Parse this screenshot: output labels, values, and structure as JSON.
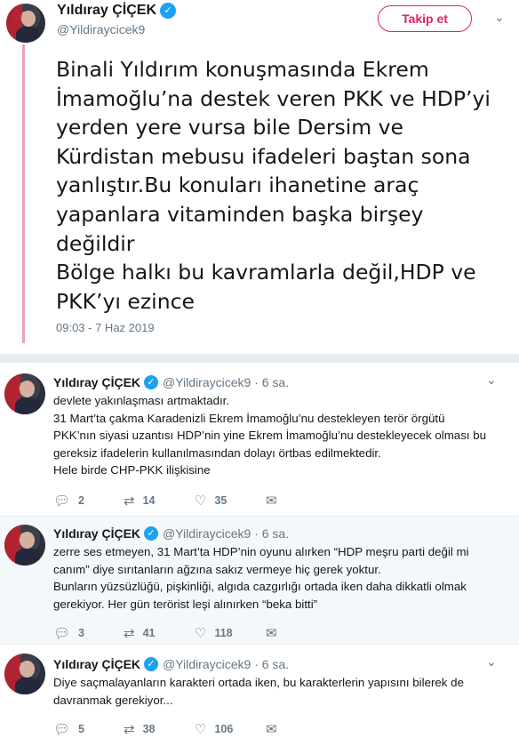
{
  "main_tweet": {
    "author_name": "Yıldıray ÇİÇEK",
    "handle": "@Yildiraycicek9",
    "follow_label": "Takip et",
    "text_lines": [
      "Binali Yıldırım konuşmasında  Ekrem",
      "İmamoğlu’na destek veren PKK ve HDP’yi",
      "yerden yere vursa bile Dersim ve",
      "Kürdistan mebusu ifadeleri baştan sona",
      "yanlıştır.Bu konuları ihanetine araç",
      "yapanlara vitaminden başka birşey",
      "değildir",
      "Bölge halkı bu kavramlarla değil,HDP ve",
      "PKK’yı ezince"
    ],
    "timestamp": "09:03 - 7 Haz 2019"
  },
  "replies": [
    {
      "author_name": "Yıldıray ÇİÇEK",
      "handle": "@Yildiraycicek9 · 6 sa.",
      "text_lines": [
        "devlete yakınlaşması artmaktadır.",
        "31 Mart’ta çakma Karadenizli Ekrem İmamoğlu’nu destekleyen terör örgütü",
        "PKK’nın siyasi uzantısı HDP’nin yine Ekrem İmamoğlu’nu destekleyecek olması bu",
        "gereksiz ifadelerin kullanılmasından dolayı örtbas edilmektedir.",
        "Hele birde CHP-PKK ilişkisine"
      ],
      "replies_count": "2",
      "retweets_count": "14",
      "likes_count": "35"
    },
    {
      "author_name": "Yıldıray ÇİÇEK",
      "handle": "@Yildiraycicek9 · 6 sa.",
      "text_lines": [
        "zerre ses etmeyen, 31 Mart’ta HDP’nin oyunu alırken “HDP meşru parti değil mi",
        "canım” diye sırıtanların ağzına sakız vermeye hiç gerek yoktur.",
        "Bunların yüzsüzlüğü, pişkinliği, algıda cazgırlığı ortada iken daha dikkatli olmak",
        "gerekiyor. Her gün terörist leşi alınırken “beka bitti”"
      ],
      "replies_count": "3",
      "retweets_count": "41",
      "likes_count": "118"
    },
    {
      "author_name": "Yıldıray ÇİÇEK",
      "handle": "@Yildiraycicek9 · 6 sa.",
      "text_lines": [
        "Diye saçmalayanların karakteri ortada iken, bu karakterlerin yapısını bilerek de",
        "davranmak gerekiyor..."
      ],
      "replies_count": "5",
      "retweets_count": "38",
      "likes_count": "106"
    }
  ],
  "icons": {
    "verified": "verified-badge-icon",
    "reply": "reply-icon",
    "retweet": "retweet-icon",
    "like": "heart-icon",
    "dm": "direct-message-icon",
    "caret": "chevron-down-icon"
  },
  "colors": {
    "accent": "#e0245e",
    "verified": "#1da1f2",
    "thread_line": "#e6a4bb",
    "secondary_text": "#657786"
  }
}
